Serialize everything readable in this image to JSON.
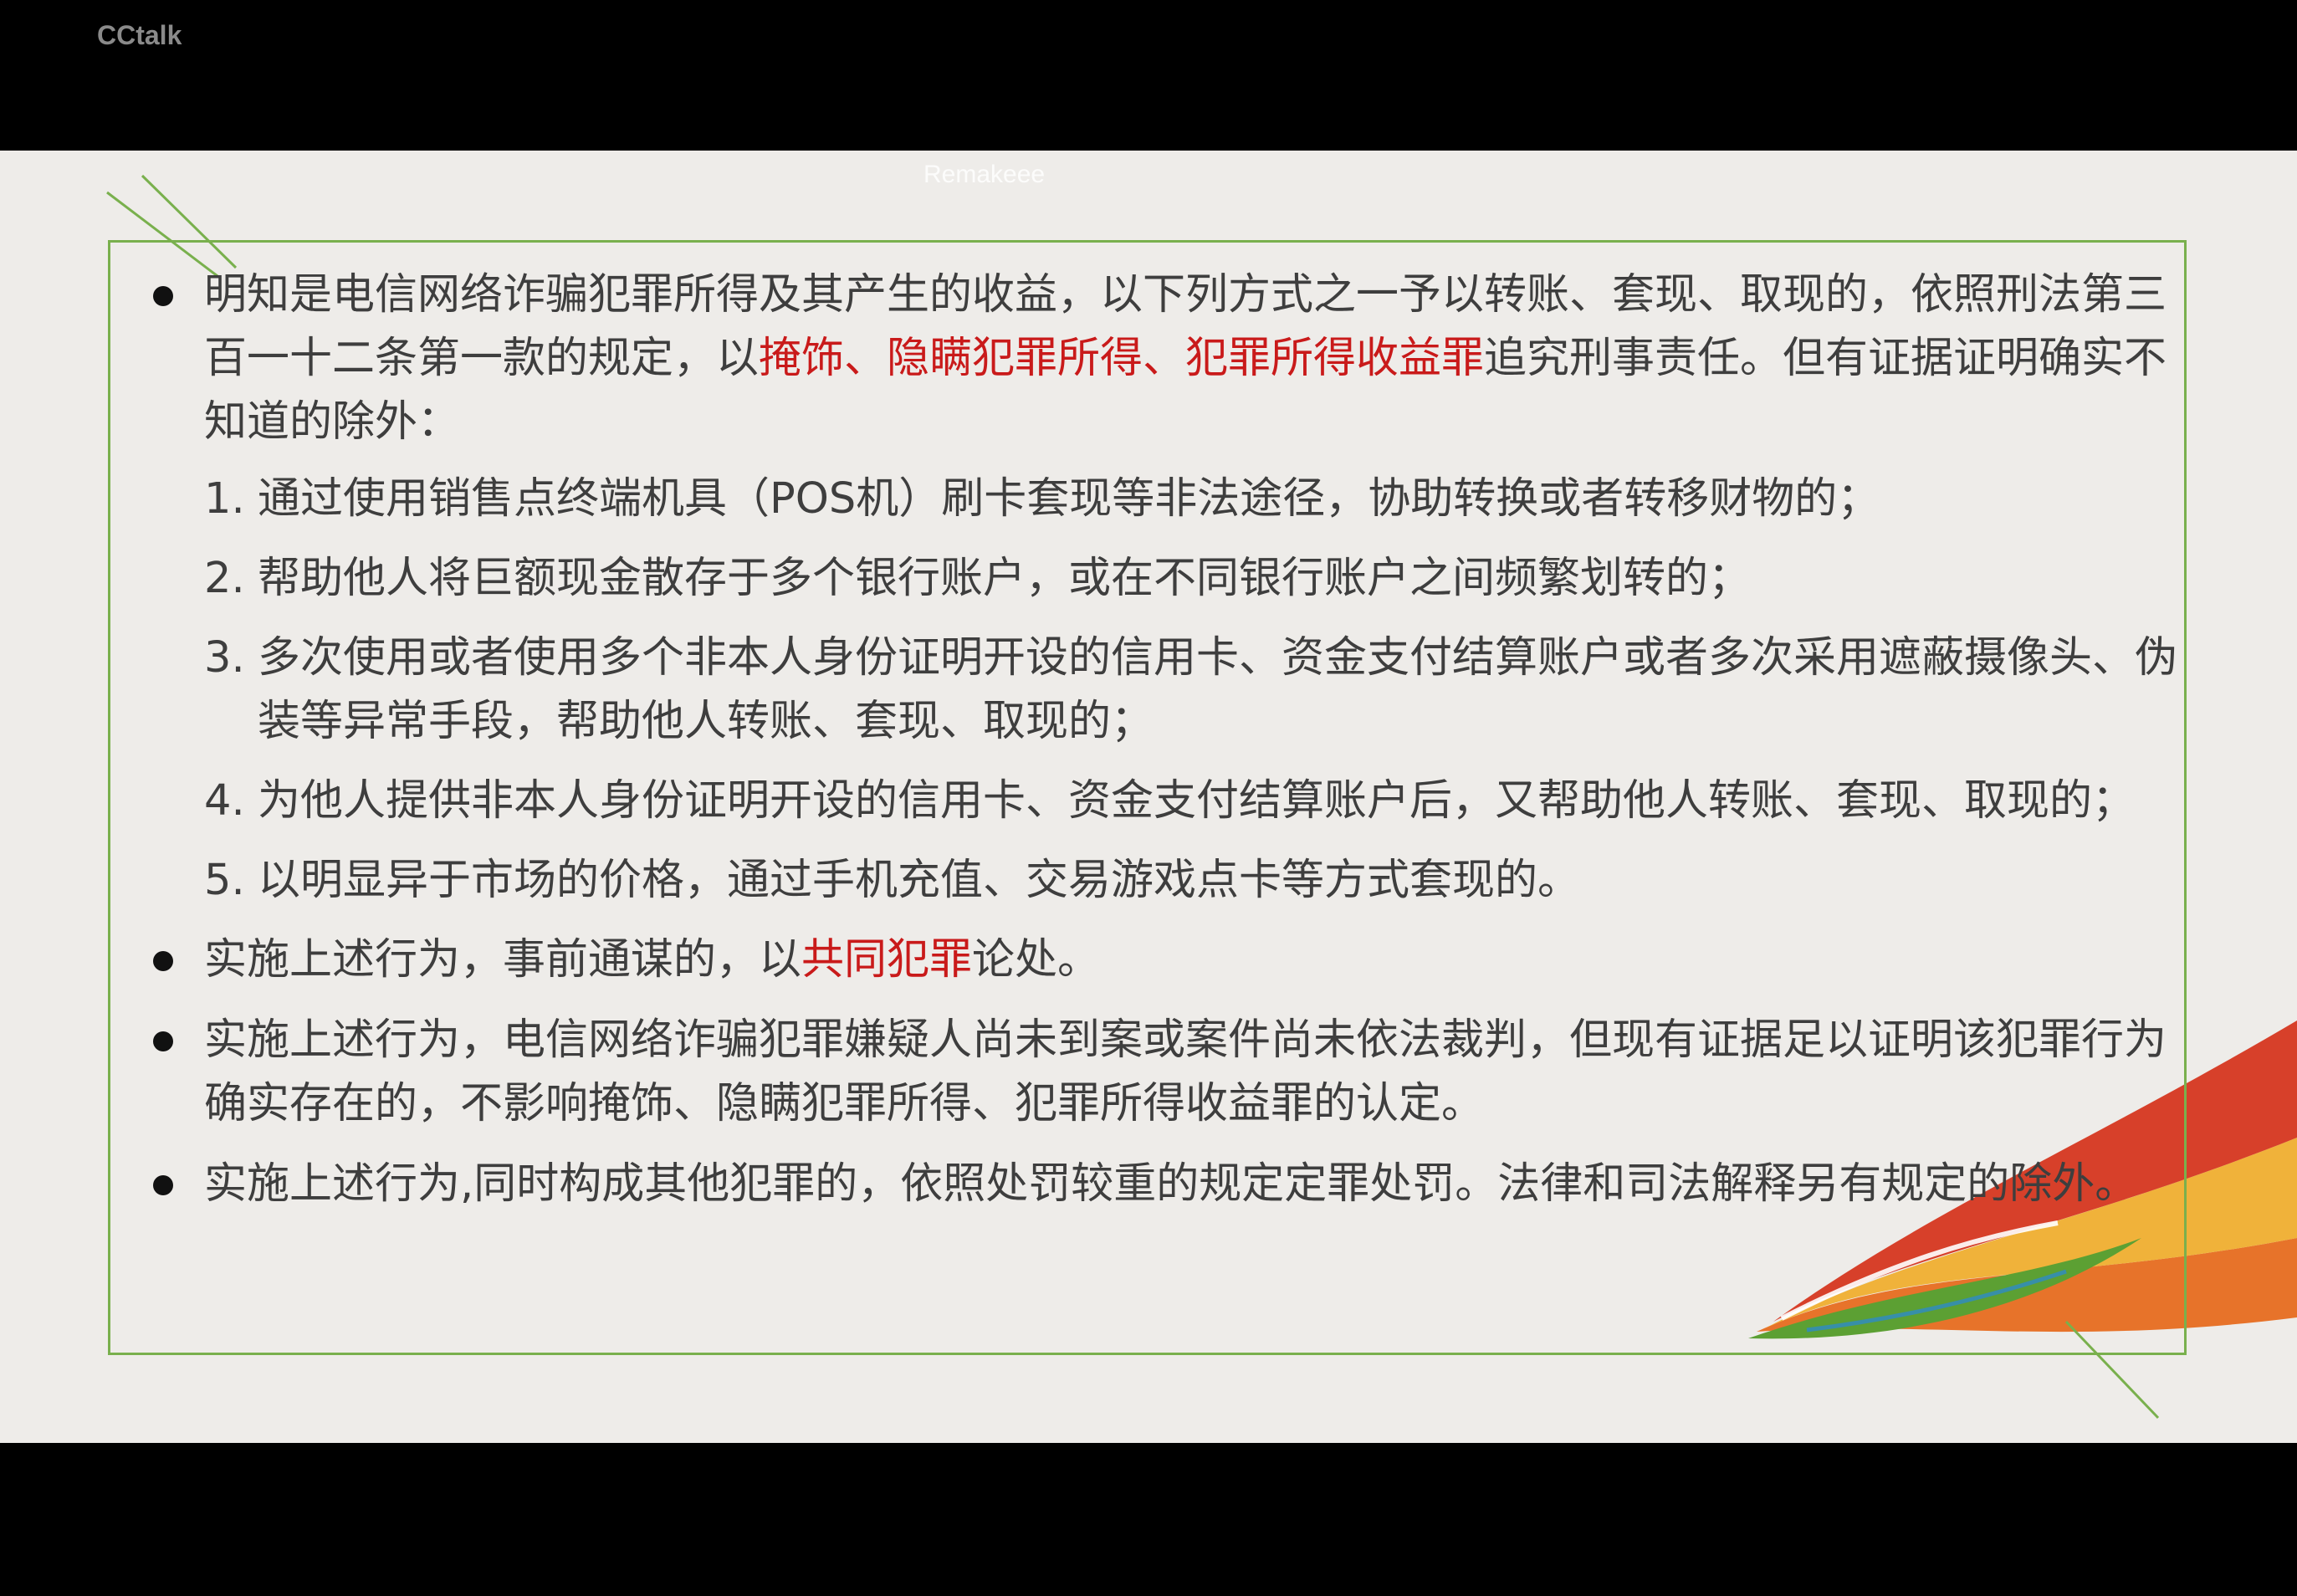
{
  "app": {
    "name": "CCtalk"
  },
  "watermark": "Remakeee",
  "slide": {
    "paragraph1": {
      "text_before": "明知是电信网络诈骗犯罪所得及其产生的收益，以下列方式之一予以转账、套现、取现的，依照刑法第三百一十二条第一款的规定，以",
      "highlight": "掩饰、隐瞒犯罪所得、犯罪所得收益罪",
      "text_after": "追究刑事责任。但有证据证明确实不知道的除外："
    },
    "items": [
      {
        "num": "1.",
        "text": "通过使用销售点终端机具（POS机）刷卡套现等非法途径，协助转换或者转移财物的；"
      },
      {
        "num": "2.",
        "text": "帮助他人将巨额现金散存于多个银行账户，或在不同银行账户之间频繁划转的；"
      },
      {
        "num": "3.",
        "text": "多次使用或者使用多个非本人身份证明开设的信用卡、资金支付结算账户或者多次采用遮蔽摄像头、伪装等异常手段，帮助他人转账、套现、取现的；"
      },
      {
        "num": "4.",
        "text": "为他人提供非本人身份证明开设的信用卡、资金支付结算账户后，又帮助他人转账、套现、取现的；"
      },
      {
        "num": "5.",
        "text": "以明显异于市场的价格，通过手机充值、交易游戏点卡等方式套现的。"
      }
    ],
    "paragraph2": {
      "text_before": "实施上述行为，事前通谋的，以",
      "highlight": "共同犯罪",
      "text_after": "论处。"
    },
    "paragraph3": "实施上述行为，电信网络诈骗犯罪嫌疑人尚未到案或案件尚未依法裁判，但现有证据足以证明该犯罪行为确实存在的，不影响掩饰、隐瞒犯罪所得、犯罪所得收益罪的认定。",
    "paragraph4": "实施上述行为,同时构成其他犯罪的，依照处罚较重的规定定罪处罚。法律和司法解释另有规定的除外。"
  },
  "colors": {
    "highlight": "#c91a1a",
    "frame": "#79b04d",
    "text": "#3e3e3e",
    "background": "#eeece9"
  }
}
